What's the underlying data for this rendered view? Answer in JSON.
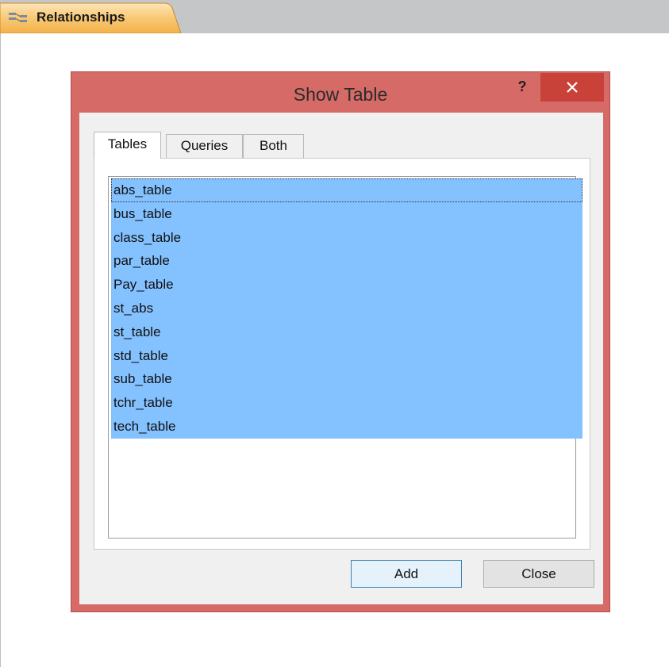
{
  "window_tab": {
    "label": "Relationships",
    "icon": "relationships-icon"
  },
  "dialog": {
    "title": "Show Table",
    "help_label": "?",
    "close_icon": "close-icon",
    "tabs": [
      {
        "label": "Tables",
        "active": true
      },
      {
        "label": "Queries",
        "active": false
      },
      {
        "label": "Both",
        "active": false
      }
    ],
    "items": [
      "abs_table",
      "bus_table",
      "class_table",
      "par_table",
      "Pay_table",
      "st_abs",
      "st_table",
      "std_table",
      "sub_table",
      "tchr_table",
      "tech_table"
    ],
    "add_label": "Add",
    "close_label": "Close"
  },
  "colors": {
    "dialog_frame": "#d56a66",
    "close_button": "#c8423a",
    "selection": "#84c1ff",
    "tab_accent": "#f3b24a"
  }
}
